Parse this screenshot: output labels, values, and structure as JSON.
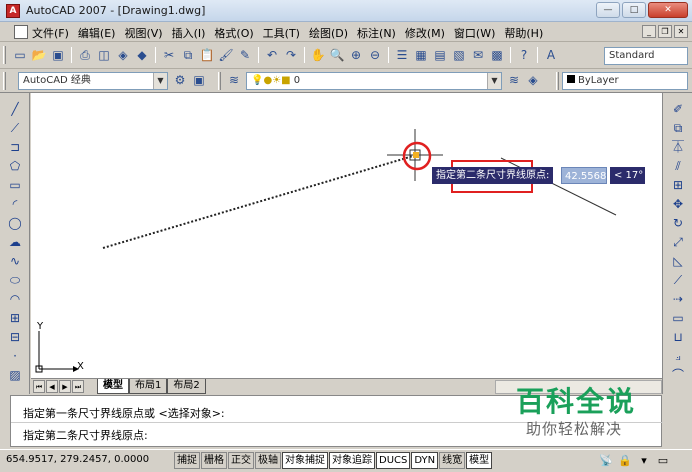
{
  "window": {
    "title": "AutoCAD 2007 - [Drawing1.dwg]",
    "app_icon_text": "A"
  },
  "menu": {
    "items": [
      "文件(F)",
      "编辑(E)",
      "视图(V)",
      "插入(I)",
      "格式(O)",
      "工具(T)",
      "绘图(D)",
      "标注(N)",
      "修改(M)",
      "窗口(W)",
      "帮助(H)"
    ]
  },
  "toolbar": {
    "text_style": "Standard",
    "workspace": "AutoCAD 经典",
    "layer": "0",
    "linetype": "ByLayer"
  },
  "canvas": {
    "prompt_label": "指定第二条尺寸界线原点:",
    "distance_value": "42.5568",
    "angle_value": "< 17°",
    "ucs_y": "Y",
    "ucs_x": "X"
  },
  "tabs": {
    "items": [
      "模型",
      "布局1",
      "布局2"
    ],
    "active": "模型"
  },
  "command": {
    "line1": "指定第一条尺寸界线原点或 <选择对象>:",
    "line2": "指定第二条尺寸界线原点:"
  },
  "status": {
    "coordinates": "654.9517, 279.2457, 0.0000",
    "buttons": [
      {
        "label": "捕捉",
        "on": false
      },
      {
        "label": "栅格",
        "on": false
      },
      {
        "label": "正交",
        "on": false
      },
      {
        "label": "极轴",
        "on": false
      },
      {
        "label": "对象捕捉",
        "on": true
      },
      {
        "label": "对象追踪",
        "on": true
      },
      {
        "label": "DUCS",
        "on": true
      },
      {
        "label": "DYN",
        "on": true
      },
      {
        "label": "线宽",
        "on": false
      },
      {
        "label": "模型",
        "on": true
      }
    ]
  },
  "watermark": {
    "title": "百科全说",
    "subtitle": "助你轻松解决"
  },
  "colors": {
    "tooltip_bg": "#2b2b6b",
    "highlight_box": "#e02020",
    "watermark": "#1aa05a"
  }
}
